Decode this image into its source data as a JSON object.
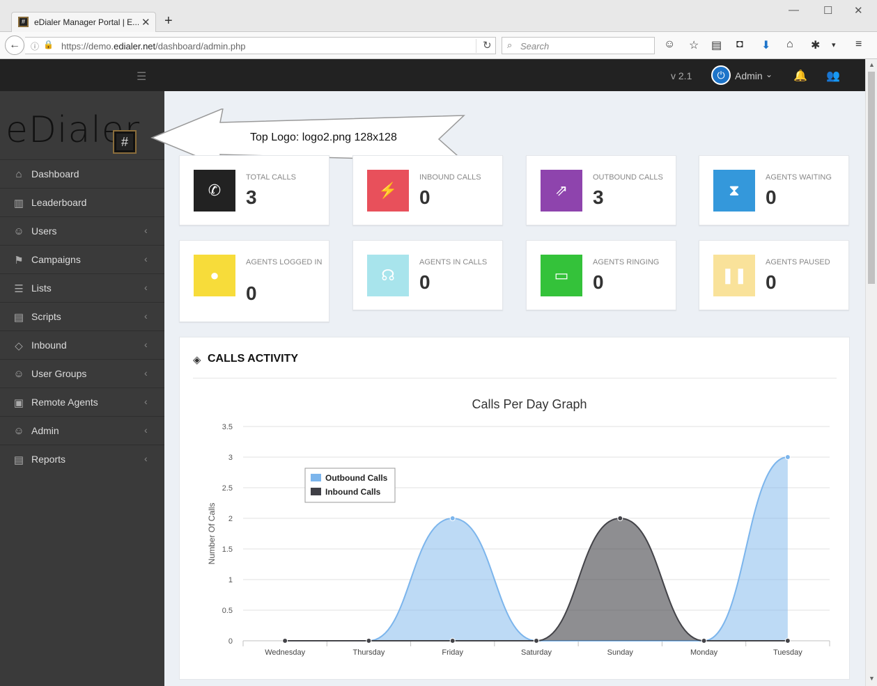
{
  "browser": {
    "tab_title": "eDialer Manager Portal | E...",
    "url_prefix": "https://demo.",
    "url_domain": "edialer.net",
    "url_path": "/dashboard/admin.php",
    "search_placeholder": "Search"
  },
  "topbar": {
    "version": "v 2.1",
    "user_name": "Admin"
  },
  "logo": {
    "text": "eDialer",
    "mark": "#"
  },
  "annotation": "Top Logo: logo2.png 128x128",
  "sidebar": {
    "items": [
      {
        "label": "Dashboard",
        "icon": "home-icon",
        "has_caret": false
      },
      {
        "label": "Leaderboard",
        "icon": "bar-chart-icon",
        "has_caret": false
      },
      {
        "label": "Users",
        "icon": "user-icon",
        "has_caret": true
      },
      {
        "label": "Campaigns",
        "icon": "flag-icon",
        "has_caret": true
      },
      {
        "label": "Lists",
        "icon": "list-icon",
        "has_caret": true
      },
      {
        "label": "Scripts",
        "icon": "code-file-icon",
        "has_caret": true
      },
      {
        "label": "Inbound",
        "icon": "diamond-icon",
        "has_caret": true
      },
      {
        "label": "User Groups",
        "icon": "user-icon",
        "has_caret": true
      },
      {
        "label": "Remote Agents",
        "icon": "agent-icon",
        "has_caret": true
      },
      {
        "label": "Admin",
        "icon": "user-icon",
        "has_caret": true
      },
      {
        "label": "Reports",
        "icon": "report-icon",
        "has_caret": true
      }
    ]
  },
  "stats": [
    {
      "label": "TOTAL CALLS",
      "value": "3",
      "color": "#222222",
      "icon": "phone-icon"
    },
    {
      "label": "INBOUND CALLS",
      "value": "0",
      "color": "#e8505b",
      "icon": "plug-icon"
    },
    {
      "label": "OUTBOUND CALLS",
      "value": "3",
      "color": "#8e44ad",
      "icon": "external-link-icon"
    },
    {
      "label": "AGENTS WAITING",
      "value": "0",
      "color": "#3498db",
      "icon": "hourglass-icon"
    },
    {
      "label": "AGENTS LOGGED IN",
      "value": "0",
      "color": "#f7dc3a",
      "icon": "user-icon"
    },
    {
      "label": "AGENTS IN CALLS",
      "value": "0",
      "color": "#a8e4ec",
      "icon": "headset-icon"
    },
    {
      "label": "AGENTS RINGING",
      "value": "0",
      "color": "#34c23a",
      "icon": "monitor-icon"
    },
    {
      "label": "AGENTS PAUSED",
      "value": "0",
      "color": "#f9e29a",
      "icon": "pause-icon"
    }
  ],
  "activity": {
    "title": "CALLS ACTIVITY"
  },
  "chart_data": {
    "type": "area",
    "title": "Calls Per Day Graph",
    "xlabel": "",
    "ylabel": "Number Of Calls",
    "categories": [
      "Wednesday",
      "Thursday",
      "Friday",
      "Saturday",
      "Sunday",
      "Monday",
      "Tuesday"
    ],
    "ylim": [
      0,
      3.5
    ],
    "yticks": [
      "0",
      "0.5",
      "1",
      "1.5",
      "2",
      "2.5",
      "3",
      "3.5"
    ],
    "grid": true,
    "legend": "top-left",
    "series": [
      {
        "name": "Outbound Calls",
        "values": [
          0,
          0,
          2,
          0,
          0,
          0,
          3
        ],
        "color": "#7cb5ec"
      },
      {
        "name": "Inbound Calls",
        "values": [
          0,
          0,
          0,
          0,
          2,
          0,
          0
        ],
        "color": "#434348"
      }
    ]
  }
}
